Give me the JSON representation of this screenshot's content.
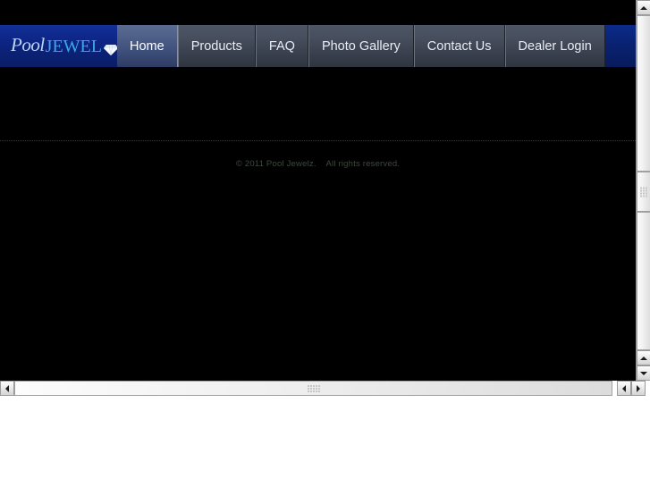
{
  "window": {
    "page_background": "#000000",
    "chrome_background": "#ffffff"
  },
  "header": {
    "background_start": "#0b2a8a",
    "background_end": "#071b5c",
    "logo": {
      "word_one": "Pool",
      "word_two": "JEWEL",
      "gem_icon": "diamond-icon",
      "word_one_color": "#bcd6f5",
      "word_two_color": "#3ba7e8"
    },
    "nav": {
      "active_index": 0,
      "active_color": "#4f6089",
      "items": [
        {
          "label": "Home",
          "active": true
        },
        {
          "label": "Products",
          "active": false
        },
        {
          "label": "FAQ",
          "active": false
        },
        {
          "label": "Photo Gallery",
          "active": false
        },
        {
          "label": "Contact Us",
          "active": false
        },
        {
          "label": "Dealer Login",
          "active": false
        }
      ]
    }
  },
  "content": {
    "divider_style": "dotted",
    "divider_color": "#3a3a3a"
  },
  "footer": {
    "copyright": "© 2011 Pool Jewelz.    All rights reserved.",
    "text_color": "#3d4a3d"
  },
  "scrollbars": {
    "vertical": {
      "up_arrow_icon": "arrow-up-icon",
      "down_arrow_icon": "arrow-down-icon",
      "thumb_grip_icon": "grip-dots-icon"
    },
    "horizontal": {
      "left_arrow_icon": "arrow-left-icon",
      "right_arrow_icon": "arrow-right-icon",
      "thumb_grip_icon": "grip-dots-icon"
    }
  }
}
